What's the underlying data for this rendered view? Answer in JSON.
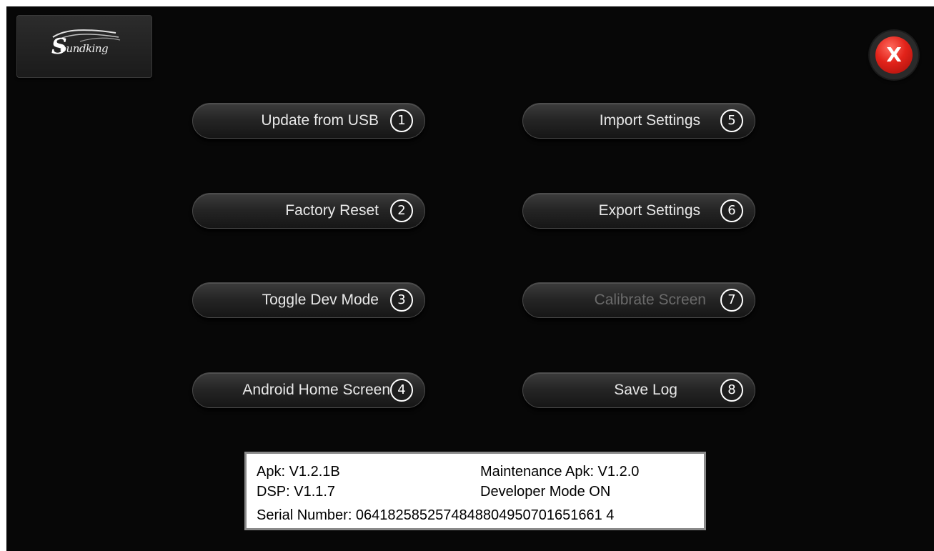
{
  "logo": {
    "text": "oundking",
    "initial": "S"
  },
  "close_button": {
    "label": "X",
    "icon": "close-icon",
    "color": "#e2231a"
  },
  "menu": {
    "buttons": [
      {
        "label": "Update from USB",
        "number": "1",
        "enabled": true
      },
      {
        "label": "Factory Reset",
        "number": "2",
        "enabled": true
      },
      {
        "label": "Toggle Dev Mode",
        "number": "3",
        "enabled": true
      },
      {
        "label": "Android Home Screen",
        "number": "4",
        "enabled": true
      },
      {
        "label": "Import Settings",
        "number": "5",
        "enabled": true
      },
      {
        "label": "Export Settings",
        "number": "6",
        "enabled": true
      },
      {
        "label": "Calibrate Screen",
        "number": "7",
        "enabled": false
      },
      {
        "label": "Save Log",
        "number": "8",
        "enabled": true
      }
    ]
  },
  "info": {
    "apk": "Apk: V1.2.1B",
    "maintenance_apk": "Maintenance Apk: V1.2.0",
    "dsp": "DSP: V1.1.7",
    "developer_mode": "Developer Mode ON",
    "serial": "Serial Number: 0641825852574848804950701651661 4"
  },
  "colors": {
    "background": "#070707",
    "button_text": "#e8e8e8",
    "disabled_text": "#6a6a6a"
  }
}
